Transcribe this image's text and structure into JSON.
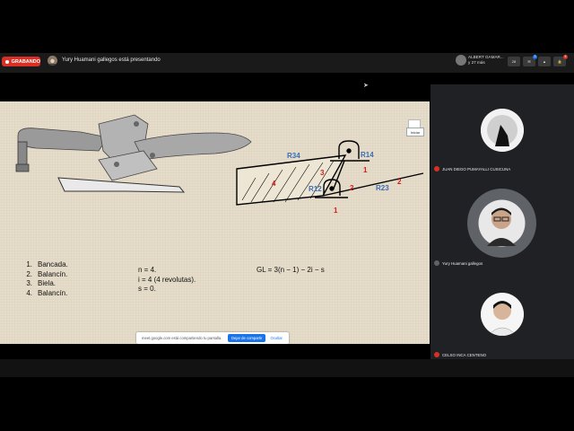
{
  "recording": {
    "label": "GRABANDO"
  },
  "presenter": {
    "text": "Yury Huamani gallegos está presentando"
  },
  "top_right": {
    "name": "ALBERT GAMAR...",
    "subtext": "y 27 más"
  },
  "top_controls": [
    {
      "icon": "people-icon",
      "label": "28",
      "badge": ""
    },
    {
      "icon": "chat-icon",
      "label": "",
      "badge": "3"
    },
    {
      "icon": "activities-icon",
      "label": "",
      "badge": ""
    },
    {
      "icon": "host-controls-icon",
      "label": "",
      "badge": "5"
    }
  ],
  "slide": {
    "start_button": "Iniciar",
    "mechanism_labels": {
      "r34": "R34",
      "r14": "R14",
      "r12": "R12",
      "r23": "R23",
      "link1_top": "1",
      "link1_bottom": "1",
      "link2_a": "2",
      "link2_b": "2",
      "link3": "3",
      "link4": "4"
    },
    "legend": [
      {
        "num": "1.",
        "text": "Bancada."
      },
      {
        "num": "2.",
        "text": "Balancín."
      },
      {
        "num": "3.",
        "text": "Biela."
      },
      {
        "num": "4.",
        "text": "Balancín."
      }
    ],
    "params": [
      "n = 4.",
      "i = 4 (4 revolutas).",
      "s = 0."
    ],
    "formula": "GL = 3(n − 1) − 2i − s",
    "colors": {
      "label_blue": "#3a6fb5",
      "label_red": "#d21c1c"
    }
  },
  "share_bar": {
    "message": "meet.google.com está compartiendo tu pantalla.",
    "stop_label": "Dejar de compartir",
    "hide_label": "Ocultar"
  },
  "participants": [
    {
      "name": "JUAN DIEGO PUMAYALLI CUSICUNA",
      "mic": "off",
      "avatar": "wolf-moon"
    },
    {
      "name": "Yury Huamani gallegos",
      "mic": "on",
      "avatar": "person-glasses"
    },
    {
      "name": "CELSO INCA CENTENO",
      "mic": "off",
      "avatar": "person"
    }
  ]
}
